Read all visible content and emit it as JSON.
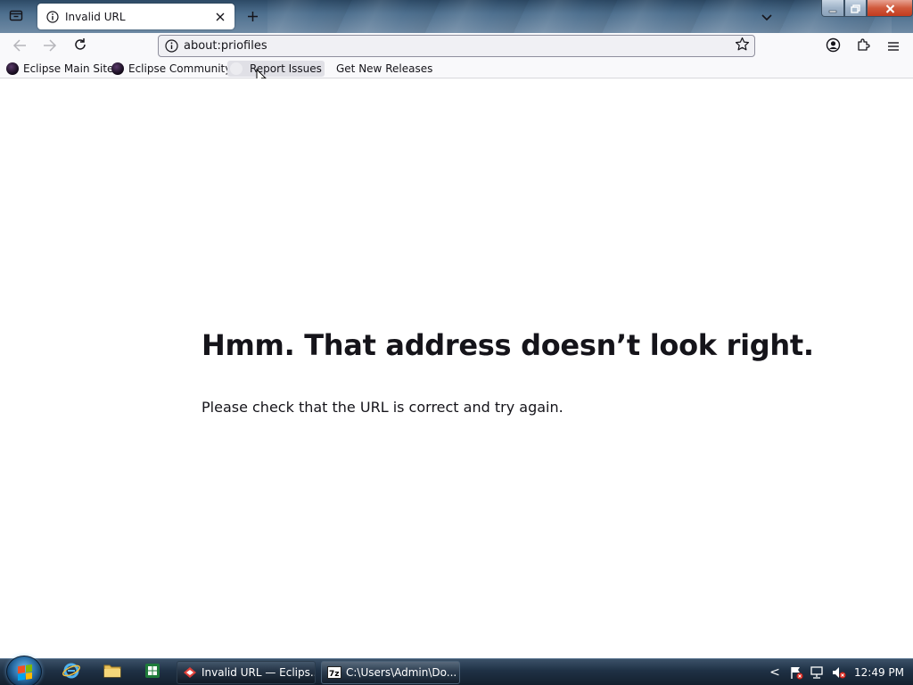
{
  "browser": {
    "tab": {
      "title": "Invalid URL",
      "close_label": "×"
    },
    "new_tab_label": "+",
    "url": "about:priofiles"
  },
  "bookmarks": [
    {
      "label": "Eclipse Main Site"
    },
    {
      "label": "Eclipse Community"
    },
    {
      "label": "Report Issues"
    },
    {
      "label": "Get New Releases"
    }
  ],
  "error_page": {
    "title": "Hmm. That address doesn’t look right.",
    "description": "Please check that the URL is correct and try again."
  },
  "taskbar": {
    "items": [
      {
        "label": "Invalid URL — Eclips..."
      },
      {
        "label": "C:\\Users\\Admin\\Do..."
      }
    ],
    "tray_expand_label": "<",
    "clock": "12:49 PM"
  },
  "colors": {
    "accent": "#0060df",
    "page_background": "#ffffff",
    "text": "#15141a",
    "toolbar": "#f9f9fb"
  }
}
